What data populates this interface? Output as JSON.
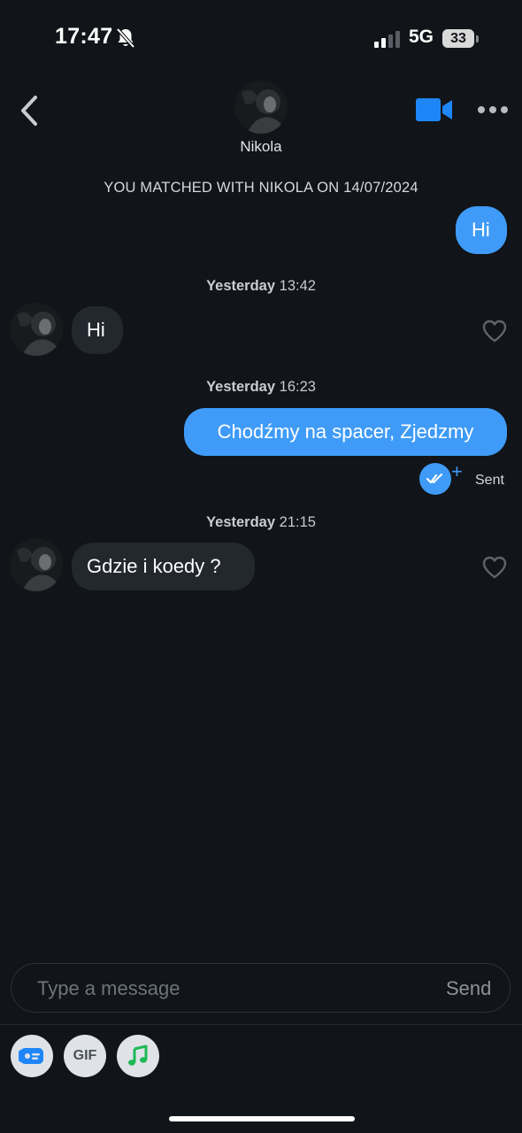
{
  "status_bar": {
    "time": "17:47",
    "network": "5G",
    "battery": "33"
  },
  "header": {
    "match_name": "Nikola",
    "icons": [
      "back-chevron-icon",
      "video-camera-icon",
      "more-dots-icon"
    ]
  },
  "match_notice": "YOU MATCHED WITH NIKOLA ON 14/07/2024",
  "messages": [
    {
      "direction": "out",
      "text": "Hi"
    },
    {
      "timestamp_day": "Yesterday",
      "timestamp_time": "13:42"
    },
    {
      "direction": "in",
      "text": "Hi"
    },
    {
      "timestamp_day": "Yesterday",
      "timestamp_time": "16:23"
    },
    {
      "direction": "out",
      "text": "Chodźmy na spacer, Zjedzmy",
      "status": "Sent"
    },
    {
      "timestamp_day": "Yesterday",
      "timestamp_time": "21:15"
    },
    {
      "direction": "in",
      "text": "Gdzie i koedy ?"
    }
  ],
  "composer": {
    "placeholder": "Type a message",
    "send_label": "Send"
  },
  "toolbar": {
    "gif_label": "GIF",
    "icons": [
      "id-card-icon",
      "gif-icon",
      "music-note-icon"
    ]
  },
  "colors": {
    "background": "#111418",
    "outgoing_bubble": "#3f9bf7",
    "incoming_bubble": "#23272e"
  }
}
